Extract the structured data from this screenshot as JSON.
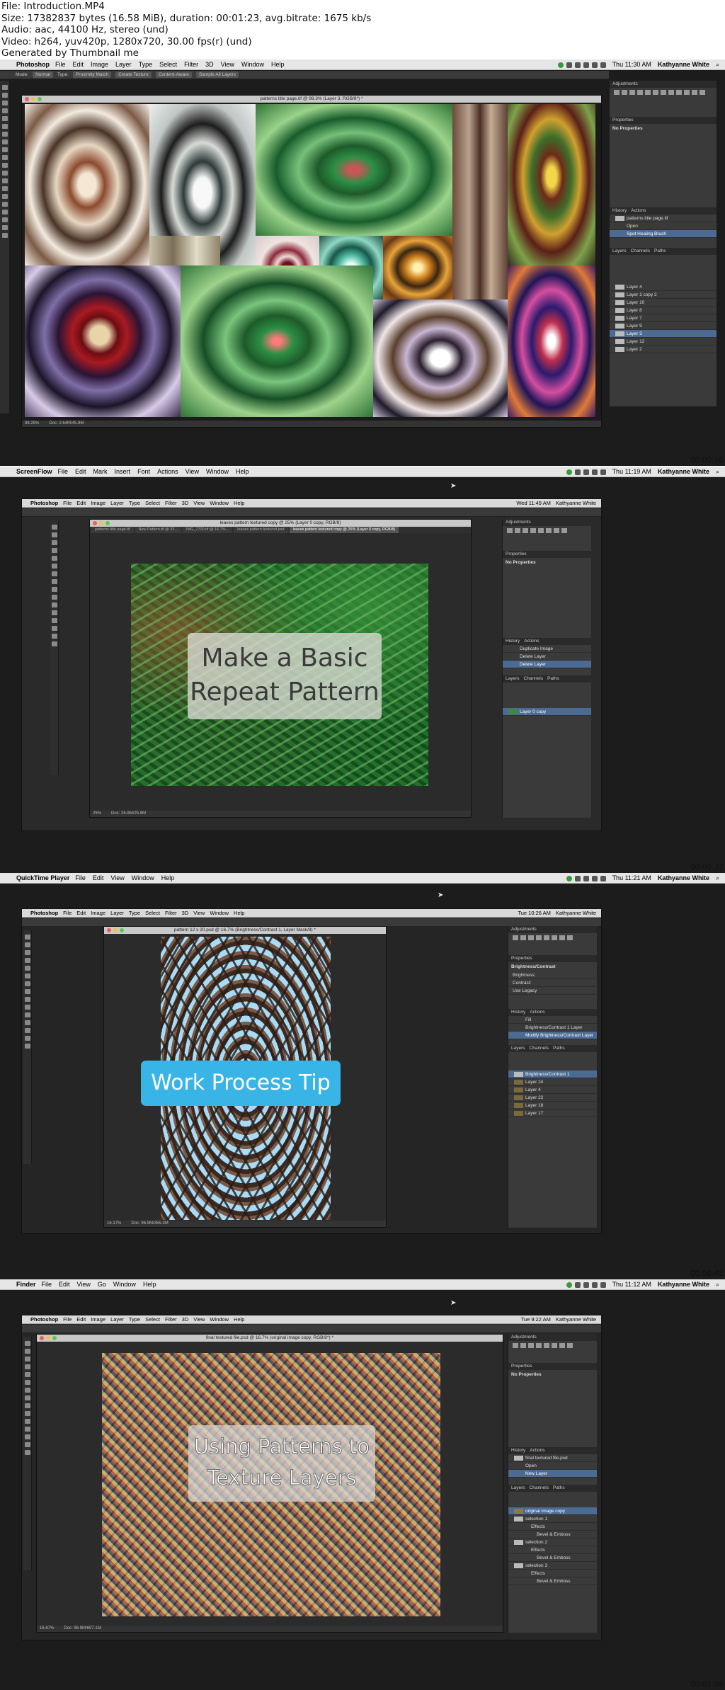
{
  "header": {
    "file": "File: Introduction.MP4",
    "size": "Size: 17382837 bytes (16.58 MiB), duration: 00:01:23, avg.bitrate: 1675 kb/s",
    "audio": "Audio: aac, 44100 Hz, stereo (und)",
    "video": "Video: h264, yuv420p, 1280x720, 30.00 fps(r) (und)",
    "generated": "Generated by Thumbnail me"
  },
  "frames": [
    {
      "mac_app": "Photoshop",
      "mac_menu": [
        "File",
        "Edit",
        "Image",
        "Layer",
        "Type",
        "Select",
        "Filter",
        "3D",
        "View",
        "Window",
        "Help"
      ],
      "clock": "Thu 11:30 AM",
      "user": "Kathyanne White",
      "timestamp": "00:00:16",
      "doc_title": "patterns title page.tif @ 98.3% (Layer 3, RGB/8*) *",
      "options": [
        "Mode:",
        "Normal",
        "Type:",
        "Proximity Match",
        "Create Texture",
        "Content-Aware",
        "Sample All Layers"
      ],
      "status_zoom": "98.25%",
      "status_doc": "Doc: 2.64M/45.9M",
      "history_title": "patterns title page.tif",
      "history_items": [
        "Open",
        "Spot Healing Brush"
      ],
      "layers": [
        "Layer 4",
        "Layer 1 copy 2",
        "Layer 10",
        "Layer 8",
        "Layer 7",
        "Layer 9",
        "Layer 3",
        "Layer 12",
        "Layer 2"
      ],
      "panel_tabs": [
        "Adjustments",
        "Properties",
        "No Properties",
        "History",
        "Actions",
        "Layers",
        "Channels",
        "Paths"
      ]
    },
    {
      "mac_app": "ScreenFlow",
      "mac_menu": [
        "File",
        "Edit",
        "Mark",
        "Insert",
        "Font",
        "Actions",
        "View",
        "Window",
        "Help"
      ],
      "clock": "Thu 11:19 AM",
      "user": "Kathyanne White",
      "timestamp": "00:00:32",
      "ps_clock": "Wed 11:49 AM",
      "ps_menu": [
        "Photoshop",
        "File",
        "Edit",
        "Image",
        "Layer",
        "Type",
        "Select",
        "Filter",
        "3D",
        "View",
        "Window",
        "Help"
      ],
      "doc_title": "leaves pattern textured copy @ 25% (Layer 0 copy, RGB/8)",
      "tabs": [
        "patterns title page.tif",
        "New Pattern.tif @ 33...",
        "IMG_7700.tif @ 16.7%...",
        "leaves pattern textured.psd",
        "leaves pattern textured copy @ 25% (Layer 0 copy, RGB/8)"
      ],
      "overlay": [
        "Make a Basic",
        "Repeat Pattern"
      ],
      "status_zoom": "25%",
      "status_doc": "Doc: 25.9M/25.9M",
      "history_items": [
        "Duplicate Image",
        "Delete Layer",
        "Delete Layer"
      ],
      "layers": [
        "Layer 0 copy"
      ]
    },
    {
      "mac_app": "QuickTime Player",
      "mac_menu": [
        "File",
        "Edit",
        "View",
        "Window",
        "Help"
      ],
      "clock": "Thu 11:21 AM",
      "user": "Kathyanne White",
      "timestamp": "00:00:48",
      "ps_clock": "Tue 10:26 AM",
      "doc_title": "pattern 12 x 20.psd @ 16.7% (Brightness/Contrast 1, Layer Mask/8) *",
      "overlay": "Work Process Tip",
      "status_zoom": "16.17%",
      "status_doc": "Doc: 96.9M/355.3M",
      "properties": "Brightness/Contrast",
      "props_rows": [
        "Brightness:",
        "Contrast:",
        "Use Legacy"
      ],
      "history_items": [
        "Fill",
        "Brightness/Contrast 1 Layer",
        "Modify Brightness/Contrast Layer"
      ],
      "layers": [
        "Brightness/Contrast 1",
        "Layer 24",
        "Layer 4",
        "Layer 22",
        "Layer 18",
        "Layer 17"
      ]
    },
    {
      "mac_app": "Finder",
      "mac_menu": [
        "File",
        "Edit",
        "View",
        "Go",
        "Window",
        "Help"
      ],
      "clock": "Thu 11:12 AM",
      "user": "Kathyanne White",
      "timestamp": "00:01:06",
      "ps_clock": "Tue 9:22 AM",
      "doc_title": "final textured file.psd @ 16.7% (original image copy, RGB/8*) *",
      "overlay": [
        "Using Patterns to",
        "Texture Layers"
      ],
      "status_zoom": "16.67%",
      "status_doc": "Doc: 96.9M/697.1M",
      "history_items": [
        "final textured file.psd",
        "Open",
        "New Layer"
      ],
      "layers": [
        "original image copy",
        "selection 1",
        "Effects",
        "Bevel & Emboss",
        "selection 2",
        "Effects",
        "Bevel & Emboss",
        "selection 3",
        "Effects",
        "Bevel & Emboss"
      ]
    }
  ],
  "colors": {
    "tip_bg": "#39b4e6",
    "overlay_bg": "#d9d9d9",
    "selected_layer": "#4c6b93"
  }
}
